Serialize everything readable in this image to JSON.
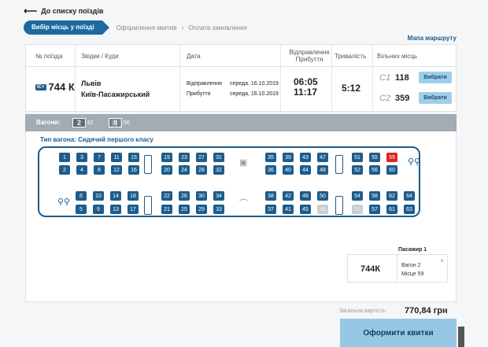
{
  "back": {
    "label": "До списку поїздів"
  },
  "steps": {
    "active": "Вибір місць у поїзді",
    "second": "Оформлення квитків",
    "third": "Оплата замовлення",
    "sep": "›"
  },
  "map_link": "Мапа маршруту",
  "table": {
    "headers": {
      "train_no": "№ поїзда",
      "route": "Звідки / Куди",
      "date": "Дата",
      "depart_arrive": "Відправлення Прибуття",
      "duration": "Тривалість",
      "free": "Вільних місць"
    },
    "row": {
      "ic": "IC+",
      "train_no": "744 К",
      "from": "Львів",
      "to": "Київ-Пасажирський",
      "dep_label": "Відправлення",
      "dep_date": "середа, 16.10.2019",
      "arr_label": "Прибуття",
      "arr_date": "середа, 16.10.2019",
      "dep_time": "06:05",
      "arr_time": "11:17",
      "duration": "5:12",
      "classes": [
        {
          "name": "С1",
          "count": "118",
          "button": "Вибрати"
        },
        {
          "name": "С2",
          "count": "359",
          "button": "Вибрати"
        }
      ]
    }
  },
  "wagons": {
    "label": "Вагони:",
    "items": [
      {
        "no": "2",
        "seats": "62"
      },
      {
        "no": "8",
        "seats": "56"
      }
    ]
  },
  "wagon_type": "Тип вагона: Сидячий першого класу",
  "seat_numbers": {
    "top_left_a": [
      "1",
      "3",
      "7",
      "11",
      "15"
    ],
    "top_left_b": [
      "2",
      "4",
      "8",
      "12",
      "16"
    ],
    "top_mid_a": [
      "19",
      "23",
      "27",
      "31"
    ],
    "top_mid_b": [
      "20",
      "24",
      "28",
      "32"
    ],
    "top_right_a": [
      "35",
      "39",
      "43",
      "47"
    ],
    "top_right_b": [
      "36",
      "40",
      "44",
      "48"
    ],
    "top_end_a": [
      "51",
      "55",
      "59"
    ],
    "top_end_b": [
      "52",
      "56",
      "60"
    ],
    "bot_left_a": [
      "6",
      "10",
      "14",
      "18"
    ],
    "bot_left_b": [
      "5",
      "9",
      "13",
      "17"
    ],
    "bot_mid_a": [
      "22",
      "26",
      "30",
      "34"
    ],
    "bot_mid_b": [
      "21",
      "25",
      "29",
      "33"
    ],
    "bot_right_a": [
      "38",
      "42",
      "46",
      "50"
    ],
    "bot_right_b": [
      "37",
      "41",
      "45",
      "49"
    ],
    "bot_end_a": [
      "54",
      "58",
      "62",
      "64"
    ],
    "bot_end_b": [
      "53",
      "57",
      "61",
      "63"
    ],
    "selected": "59",
    "unavailable": [
      "49",
      "53"
    ]
  },
  "passenger": {
    "title": "Пасажир 1",
    "train": "744К",
    "wagon": "Вагон 2",
    "seat": "Місце 59",
    "close": "×"
  },
  "total": {
    "label": "Загальна вартість:",
    "value": "770,84 грн"
  },
  "buy_button": "Оформити квитки"
}
